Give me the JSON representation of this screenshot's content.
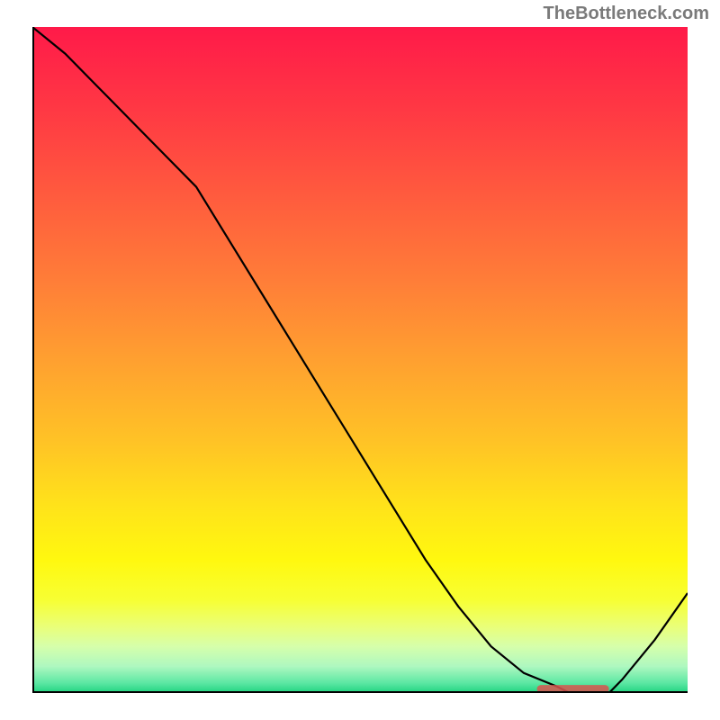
{
  "watermark": "TheBottleneck.com",
  "chart_data": {
    "type": "line",
    "title": "",
    "xlabel": "",
    "ylabel": "",
    "xlim": [
      0,
      100
    ],
    "ylim": [
      0,
      100
    ],
    "x": [
      0,
      5,
      10,
      15,
      20,
      25,
      30,
      35,
      40,
      45,
      50,
      55,
      60,
      65,
      70,
      75,
      80,
      82,
      85,
      88,
      90,
      95,
      100
    ],
    "values": [
      100,
      96,
      91,
      86,
      81,
      76,
      68,
      60,
      52,
      44,
      36,
      28,
      20,
      13,
      7,
      3,
      1,
      0,
      0,
      0,
      2,
      8,
      15
    ],
    "marker": {
      "x_start": 77,
      "x_end": 88,
      "y": 0,
      "height": 1.2
    },
    "gradient_stops": [
      {
        "offset": 0.0,
        "color": "#ff1a49"
      },
      {
        "offset": 0.12,
        "color": "#ff3744"
      },
      {
        "offset": 0.25,
        "color": "#ff5a3e"
      },
      {
        "offset": 0.38,
        "color": "#ff7d38"
      },
      {
        "offset": 0.5,
        "color": "#ffa030"
      },
      {
        "offset": 0.62,
        "color": "#ffc226"
      },
      {
        "offset": 0.72,
        "color": "#ffe31a"
      },
      {
        "offset": 0.8,
        "color": "#fff80f"
      },
      {
        "offset": 0.86,
        "color": "#f7ff33"
      },
      {
        "offset": 0.9,
        "color": "#eaff78"
      },
      {
        "offset": 0.93,
        "color": "#d6ffab"
      },
      {
        "offset": 0.96,
        "color": "#aef8c0"
      },
      {
        "offset": 0.985,
        "color": "#5ce7a3"
      },
      {
        "offset": 1.0,
        "color": "#1fd37f"
      }
    ]
  }
}
